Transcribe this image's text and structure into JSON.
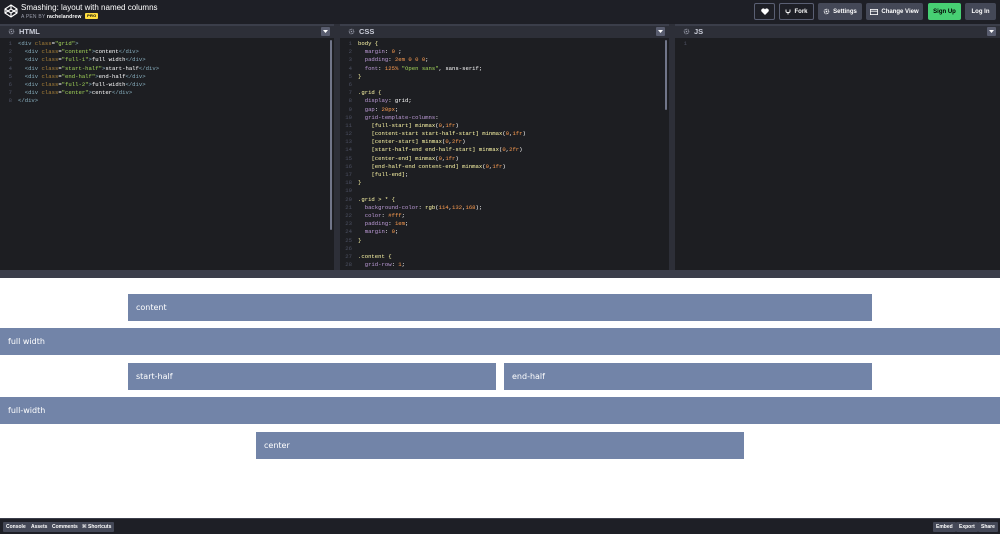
{
  "header": {
    "title": "Smashing: layout with named columns",
    "author_prefix": "A PEN BY",
    "author": "rachelandrew",
    "pro_badge": "PRO",
    "buttons": {
      "fork": "Fork",
      "settings": "Settings",
      "change_view": "Change View",
      "sign_up": "Sign Up",
      "log_in": "Log In"
    }
  },
  "editors": {
    "html": {
      "title": "HTML",
      "lines": [
        "<div class=\"grid\">",
        "  <div class=\"content\">content</div>",
        "  <div class=\"full-1\">full width</div>",
        "  <div class=\"start-half\">start-half</div>",
        "  <div class=\"end-half\">end-half</div>",
        "  <div class=\"full-2\">full-width</div>",
        "  <div class=\"center\">center</div>",
        "</div>"
      ]
    },
    "css": {
      "title": "CSS",
      "lines": [
        "body {",
        "  margin: 0 ;",
        "  padding: 2em 0 0 0;",
        "  font: 125% \"Open sans\", sans-serif;",
        "}",
        "",
        ".grid {",
        "  display: grid;",
        "  gap: 20px;",
        "  grid-template-columns:",
        "    [full-start] minmax(0,1fr)",
        "    [content-start start-half-start] minmax(0,1fr)",
        "    [center-start] minmax(0,2fr)",
        "    [start-half-end end-half-start] minmax(0,2fr)",
        "    [center-end] minmax(0,1fr)",
        "    [end-half-end content-end] minmax(0,1fr)",
        "    [full-end];",
        "}",
        "",
        ".grid > * {",
        "  background-color: rgb(114,132,168);",
        "  color: #fff;",
        "  padding: 1em;",
        "  margin: 0;",
        "}",
        "",
        ".content {",
        "  grid-row: 1;"
      ]
    },
    "js": {
      "title": "JS",
      "lines": [
        ""
      ]
    }
  },
  "preview": {
    "items": {
      "content": "content",
      "full_1": "full width",
      "start_half": "start-half",
      "end_half": "end-half",
      "full_2": "full-width",
      "center": "center"
    },
    "item_color": "#7284a8"
  },
  "footer": {
    "left": [
      "Console",
      "Assets",
      "Comments",
      "⌘ Shortcuts"
    ],
    "right": [
      "Embed",
      "Export",
      "Share"
    ]
  },
  "colors": {
    "header_bg": "#1e1f26",
    "editor_bg": "#1d1e22",
    "sign_up_green": "#47cf73",
    "pro_yellow": "#ffdd40"
  }
}
